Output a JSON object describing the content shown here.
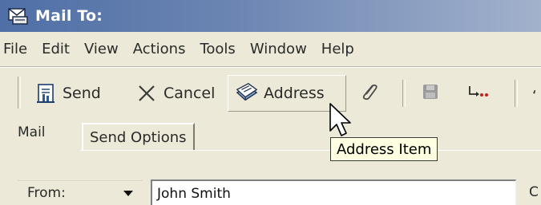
{
  "window": {
    "title": "Mail To:",
    "title_icon": "mail-compose-icon"
  },
  "menubar": {
    "items": [
      {
        "label": "File"
      },
      {
        "label": "Edit"
      },
      {
        "label": "View"
      },
      {
        "label": "Actions"
      },
      {
        "label": "Tools"
      },
      {
        "label": "Window"
      },
      {
        "label": "Help"
      }
    ]
  },
  "toolbar": {
    "send_label": "Send",
    "send_icon": "send-icon",
    "cancel_label": "Cancel",
    "cancel_icon": "cancel-x-icon",
    "address_label": "Address",
    "address_icon": "address-book-icon",
    "attach_icon": "paperclip-icon",
    "save_icon": "save-disk-icon",
    "routing_icon": "routing-slip-icon",
    "partial_right_label": "‘"
  },
  "tabs": {
    "mail_label": "Mail",
    "send_options_label": "Send Options"
  },
  "tooltip": {
    "text": "Address Item"
  },
  "form": {
    "from_label": "From:",
    "from_value": "John Smith",
    "cc_partial_label": "C"
  },
  "colors": {
    "titlebar_start": "#4f6fa6",
    "titlebar_end": "#a2b2cc",
    "window_bg": "#ece9d8",
    "tooltip_bg": "#ffffe1"
  }
}
